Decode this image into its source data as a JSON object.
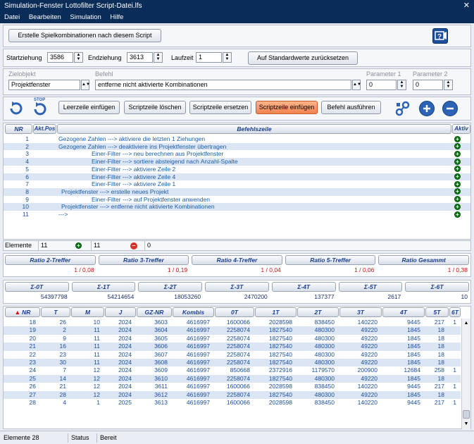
{
  "window": {
    "title": "Simulation-Fenster  Lottofilter Script-Datei.lfs",
    "close": "✕"
  },
  "menu": [
    "Datei",
    "Bearbeiten",
    "Simulation",
    "Hilfe"
  ],
  "top": {
    "create_button": "Erstelle Spielkombinationen nach diesem Script",
    "help_icon": "help-video-icon"
  },
  "params": {
    "start_label": "Startziehung",
    "start_value": "3586",
    "end_label": "Endziehung",
    "end_value": "3613",
    "run_label": "Laufzeit",
    "run_value": "1",
    "reset_button": "Auf Standardwerte zurücksetzen"
  },
  "command": {
    "target_label": "Zielobjekt",
    "target_value": "Projektfenster",
    "cmd_label": "Befehl",
    "cmd_value": "entferne nicht aktivierte Kombinationen",
    "p1_label": "Parameter 1",
    "p1_value": "0",
    "p2_label": "Parameter 2",
    "p2_value": "0"
  },
  "toolbar": {
    "stop_label": "STOP",
    "empty_line": "Leerzeile einfügen",
    "delete_line": "Scriptzeile löschen",
    "replace_line": "Scriptzeile ersetzen",
    "insert_line": "Scriptzeile einfügen",
    "execute": "Befehl ausführen"
  },
  "script": {
    "headers": {
      "nr": "NR",
      "pos": "Akt.Pos",
      "cmd": "Befehlszeile",
      "active": "Aktiv"
    },
    "rows": [
      {
        "nr": "1",
        "text": "Gezogene Zahlen ---> aktiviere die letzten 1 Ziehungen",
        "indent": 0
      },
      {
        "nr": "2",
        "text": "Gezogene Zahlen ---> deaktiviere ins Projektfenster übertragen",
        "indent": 0
      },
      {
        "nr": "3",
        "text": "Einer-Filter ---> neu berechnen aus Projektfenster",
        "indent": 1
      },
      {
        "nr": "4",
        "text": "Einer-Filter ---> sortiere absteigend nach Anzahl-Spalte",
        "indent": 1
      },
      {
        "nr": "5",
        "text": "Einer-Filter ---> aktiviere Zeile 2",
        "indent": 1
      },
      {
        "nr": "6",
        "text": "Einer-Filter ---> aktiviere Zeile 4",
        "indent": 1
      },
      {
        "nr": "7",
        "text": "Einer-Filter ---> aktiviere Zeile 1",
        "indent": 1
      },
      {
        "nr": "8",
        "text": "Projektfenster ---> erstelle neues Projekt",
        "indent": 2
      },
      {
        "nr": "9",
        "text": "Einer-Filter ---> auf Projektfenster anwenden",
        "indent": 1
      },
      {
        "nr": "10",
        "text": "Projektfenster ---> entferne nicht aktivierte Kombinationen",
        "indent": 2
      },
      {
        "nr": "11",
        "text": "--->",
        "indent": 0
      }
    ]
  },
  "script_status": {
    "label": "Elemente",
    "count": "11",
    "active": "11",
    "inactive": "0"
  },
  "ratio": {
    "headers": [
      "Ratio 2-Treffer",
      "Ratio 3-Treffer",
      "Ratio 4-Treffer",
      "Ratio 5-Treffer",
      "Ratio Gesammt"
    ],
    "values": [
      "1 / 0,08",
      "1 / 0,19",
      "1 / 0,04",
      "1 / 0,06",
      "1 / 0,38"
    ]
  },
  "sums": {
    "headers": [
      "Σ-0T",
      "Σ-1T",
      "Σ-2T",
      "Σ-3T",
      "Σ-4T",
      "Σ-5T",
      "Σ-6T"
    ],
    "values": [
      "54397798",
      "54214654",
      "18053260",
      "2470200",
      "137377",
      "2617",
      "10"
    ]
  },
  "results": {
    "sort_arrow": "▲",
    "headers": [
      "NR",
      "T",
      "M",
      "J",
      "GZ-NR",
      "Kombis",
      "0T",
      "1T",
      "2T",
      "3T",
      "4T",
      "5T",
      "6T"
    ],
    "rows": [
      [
        "18",
        "26",
        "10",
        "2024",
        "3603",
        "4616997",
        "1600066",
        "2028598",
        "838450",
        "140220",
        "9445",
        "217",
        "1"
      ],
      [
        "19",
        "2",
        "11",
        "2024",
        "3604",
        "4616997",
        "2258074",
        "1827540",
        "480300",
        "49220",
        "1845",
        "18",
        ""
      ],
      [
        "20",
        "9",
        "11",
        "2024",
        "3605",
        "4616997",
        "2258074",
        "1827540",
        "480300",
        "49220",
        "1845",
        "18",
        ""
      ],
      [
        "21",
        "16",
        "11",
        "2024",
        "3606",
        "4616997",
        "2258074",
        "1827540",
        "480300",
        "49220",
        "1845",
        "18",
        ""
      ],
      [
        "22",
        "23",
        "11",
        "2024",
        "3607",
        "4616997",
        "2258074",
        "1827540",
        "480300",
        "49220",
        "1845",
        "18",
        ""
      ],
      [
        "23",
        "30",
        "11",
        "2024",
        "3608",
        "4616997",
        "2258074",
        "1827540",
        "480300",
        "49220",
        "1845",
        "18",
        ""
      ],
      [
        "24",
        "7",
        "12",
        "2024",
        "3609",
        "4616997",
        "850668",
        "2372916",
        "1179570",
        "200900",
        "12684",
        "258",
        "1"
      ],
      [
        "25",
        "14",
        "12",
        "2024",
        "3610",
        "4616997",
        "2258074",
        "1827540",
        "480300",
        "49220",
        "1845",
        "18",
        ""
      ],
      [
        "26",
        "21",
        "12",
        "2024",
        "3611",
        "4616997",
        "1600066",
        "2028598",
        "838450",
        "140220",
        "9445",
        "217",
        "1"
      ],
      [
        "27",
        "28",
        "12",
        "2024",
        "3612",
        "4616997",
        "2258074",
        "1827540",
        "480300",
        "49220",
        "1845",
        "18",
        ""
      ],
      [
        "28",
        "4",
        "1",
        "2025",
        "3613",
        "4616997",
        "1600066",
        "2028598",
        "838450",
        "140220",
        "9445",
        "217",
        "1"
      ]
    ]
  },
  "statusbar": {
    "elements": "Elemente 28",
    "status": "Status",
    "state": "Bereit"
  }
}
